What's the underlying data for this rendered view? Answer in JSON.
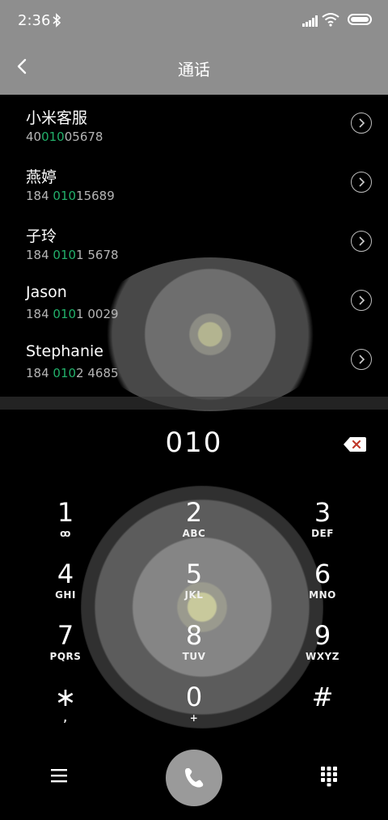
{
  "status_bar": {
    "time": "2:36"
  },
  "header": {
    "title": "通话"
  },
  "contacts": [
    {
      "name": "小米客服",
      "num_pre": "40",
      "num_hl": "010",
      "num_post": "05678"
    },
    {
      "name": "燕婷",
      "num_pre": "184 ",
      "num_hl": "010",
      "num_post": "15689"
    },
    {
      "name": "子玲",
      "num_pre": "184 ",
      "num_hl": "010",
      "num_post": "1 5678"
    },
    {
      "name": "Jason",
      "num_pre": "184 ",
      "num_hl": "010",
      "num_post": "1 0029"
    },
    {
      "name": "Stephanie",
      "num_pre": "184 ",
      "num_hl": "010",
      "num_post": "2 4685"
    }
  ],
  "dialer": {
    "input": "010"
  },
  "keypad": [
    {
      "digit": "1",
      "letters": "ꝏ"
    },
    {
      "digit": "2",
      "letters": "ABC"
    },
    {
      "digit": "3",
      "letters": "DEF"
    },
    {
      "digit": "4",
      "letters": "GHI"
    },
    {
      "digit": "5",
      "letters": "JKL"
    },
    {
      "digit": "6",
      "letters": "MNO"
    },
    {
      "digit": "7",
      "letters": "PQRS"
    },
    {
      "digit": "8",
      "letters": "TUV"
    },
    {
      "digit": "9",
      "letters": "WXYZ"
    },
    {
      "digit": "∗",
      "letters": ","
    },
    {
      "digit": "0",
      "letters": "+"
    },
    {
      "digit": "#",
      "letters": ""
    }
  ],
  "icons": {
    "back": "back-arrow-icon",
    "delete": "backspace-icon",
    "menu": "menu-icon",
    "call": "phone-icon",
    "keypad": "keypad-icon"
  }
}
